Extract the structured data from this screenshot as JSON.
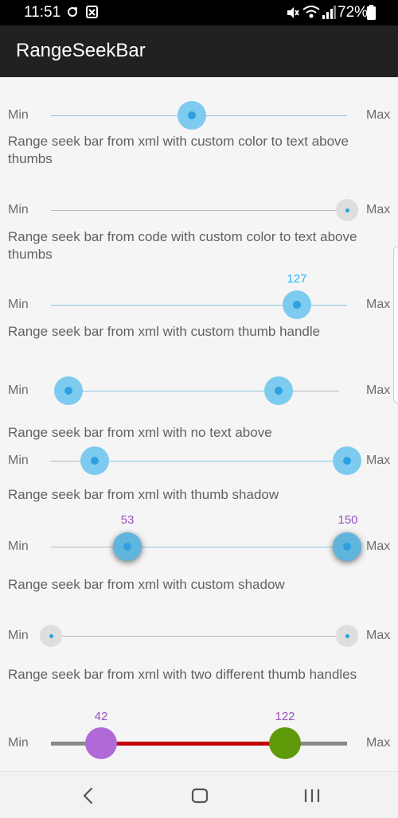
{
  "status_bar": {
    "time": "11:51",
    "battery": "72%",
    "icons": [
      "sync-icon",
      "photo-icon",
      "mute-icon",
      "wifi-icon",
      "signal-icon",
      "battery-icon"
    ]
  },
  "app_bar": {
    "title": "RangeSeekBar"
  },
  "common": {
    "min": "Min",
    "max": "Max"
  },
  "seekbars": [
    {
      "description": "Range seek bar from xml with custom color to text above thumbs",
      "thumb_text": "",
      "thumb_level": 0.47
    },
    {
      "description": "Range seek bar from code with custom color to text above thumbs",
      "thumb_level": 1.0
    },
    {
      "description": "Range seek bar from xml with custom thumb handle",
      "thumb_text": "127",
      "thumb_text_color": "#29b6f6",
      "thumb_level": 0.83
    },
    {
      "description": "Range seek bar from xml with no text above",
      "min_text": "",
      "max_text": "",
      "thumb_level_min": 0.08,
      "thumb_level_max": 0.79
    },
    {
      "description": "Range seek bar from xml with thumb shadow",
      "thumb_level_min": 0.15,
      "thumb_level_max": 1.0
    },
    {
      "description": "Range seek bar from xml with custom shadow",
      "min_text": "53",
      "max_text": "150",
      "text_color": "#9c4fc2",
      "thumb_level_min": 0.26,
      "thumb_level_max": 1.0
    },
    {
      "description": "Range seek bar from xml with two different thumb handles",
      "thumb_level_min": 0.0,
      "thumb_level_max": 1.0
    },
    {
      "min_text": "42",
      "max_text": "122",
      "text_color": "#9c4fc2",
      "thumb_level_min": 0.17,
      "thumb_level_max": 0.79,
      "range_color": "#c30000",
      "track_color": "#8a8a8a"
    }
  ],
  "nav_bar": {
    "icons": [
      "back-icon",
      "home-icon",
      "recents-icon"
    ]
  },
  "colors": {
    "status_bar": "#000000",
    "app_bar": "#212121",
    "background": "#f5f5f5",
    "thumb_blue": "#7dcbee",
    "thumb_dot": "#2f9fe0"
  }
}
